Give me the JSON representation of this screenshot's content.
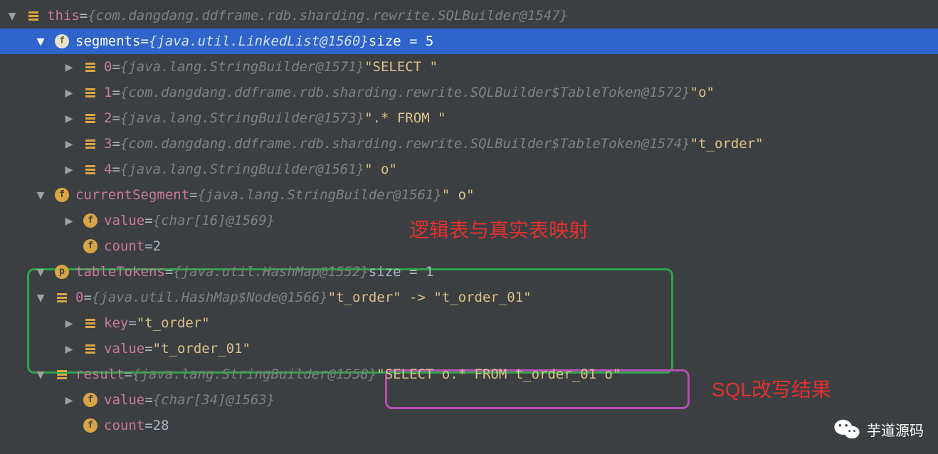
{
  "rows": {
    "r0": {
      "name": "this",
      "type": "{com.dangdang.ddframe.rdb.sharding.rewrite.SQLBuilder@1547}"
    },
    "r1": {
      "name": "segments",
      "type": "{java.util.LinkedList@1560}",
      "size": "size = 5"
    },
    "r2": {
      "name": "0",
      "type": "{java.lang.StringBuilder@1571}",
      "str": "\"SELECT \""
    },
    "r3": {
      "name": "1",
      "type": "{com.dangdang.ddframe.rdb.sharding.rewrite.SQLBuilder$TableToken@1572}",
      "str": "\"o\""
    },
    "r4": {
      "name": "2",
      "type": "{java.lang.StringBuilder@1573}",
      "str": "\".* FROM \""
    },
    "r5": {
      "name": "3",
      "type": "{com.dangdang.ddframe.rdb.sharding.rewrite.SQLBuilder$TableToken@1574}",
      "str": "\"t_order\""
    },
    "r6": {
      "name": "4",
      "type": "{java.lang.StringBuilder@1561}",
      "str": "\" o\""
    },
    "r7": {
      "name": "currentSegment",
      "type": "{java.lang.StringBuilder@1561}",
      "str": "\" o\""
    },
    "r8": {
      "name": "value",
      "type": "{char[16]@1569}"
    },
    "r9": {
      "name": "count",
      "val": "2"
    },
    "r10": {
      "name": "tableTokens",
      "type": "{java.util.HashMap@1552}",
      "size": "size = 1"
    },
    "r11": {
      "name": "0",
      "type": "{java.util.HashMap$Node@1566}",
      "str": "\"t_order\" -> \"t_order_01\""
    },
    "r12": {
      "name": "key",
      "str": "\"t_order\""
    },
    "r13": {
      "name": "value",
      "str": "\"t_order_01\""
    },
    "r14": {
      "name": "result",
      "type": "{java.lang.StringBuilder@1558}",
      "str": "\"SELECT o.* FROM t_order_01 o\""
    },
    "r15": {
      "name": "value",
      "type": "{char[34]@1563}"
    },
    "r16": {
      "name": "count",
      "val": "28"
    }
  },
  "eq": " = ",
  "sp": "  ",
  "annotations": {
    "a1": "逻辑表与真实表映射",
    "a2": "SQL改写结果"
  },
  "watermark": "芋道源码"
}
